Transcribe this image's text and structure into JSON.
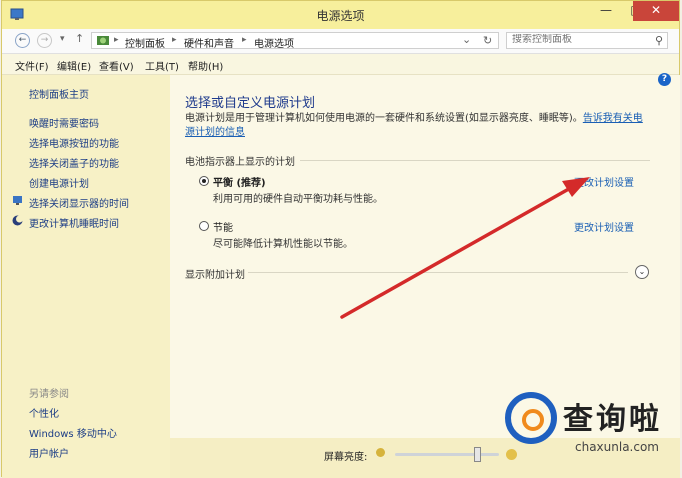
{
  "window": {
    "title": "电源选项",
    "min_label": "—",
    "max_label": "□",
    "close_label": "✕"
  },
  "address": {
    "back_glyph": "←",
    "forward_glyph": "→",
    "dropdown_glyph": "▾",
    "up_glyph": "↑",
    "crumbs": [
      "控制面板",
      "硬件和声音",
      "电源选项"
    ],
    "crumb_sep": "▸",
    "path_dropdown_glyph": "⌄",
    "refresh_glyph": "↻",
    "search_placeholder": "搜索控制面板",
    "search_glyph": "⚲"
  },
  "menu": [
    "文件(F)",
    "编辑(E)",
    "查看(V)",
    "工具(T)",
    "帮助(H)"
  ],
  "sidebar": {
    "home": "控制面板主页",
    "links": [
      "唤醒时需要密码",
      "选择电源按钮的功能",
      "选择关闭盖子的功能",
      "创建电源计划",
      "选择关闭显示器的时间",
      "更改计算机睡眠时间"
    ],
    "see_also_heading": "另请参阅",
    "see_also": [
      "个性化",
      "Windows 移动中心",
      "用户帐户"
    ]
  },
  "main": {
    "title": "选择或自定义电源计划",
    "description": "电源计划是用于管理计算机如何使用电源的一套硬件和系统设置(如显示器亮度、睡眠等)。",
    "description_link": "告诉我有关电源计划的信息",
    "group_label": "电池指示器上显示的计划",
    "plans": [
      {
        "name": "平衡 (推荐)",
        "desc": "利用可用的硬件自动平衡功耗与性能。",
        "link": "更改计划设置",
        "selected": true
      },
      {
        "name": "节能",
        "desc": "尽可能降低计算机性能以节能。",
        "link": "更改计划设置",
        "selected": false
      }
    ],
    "extra_plans_label": "显示附加计划",
    "expand_glyph": "⌄",
    "help_glyph": "?"
  },
  "brightness": {
    "label": "屏幕亮度:",
    "level": 0.8
  },
  "watermark": {
    "title": "查询啦",
    "url": "chaxunla.com"
  },
  "colors": {
    "arrow": "#d42a2a",
    "link": "#1a5fb4",
    "title": "#1e3a8c",
    "close": "#c9453a"
  }
}
